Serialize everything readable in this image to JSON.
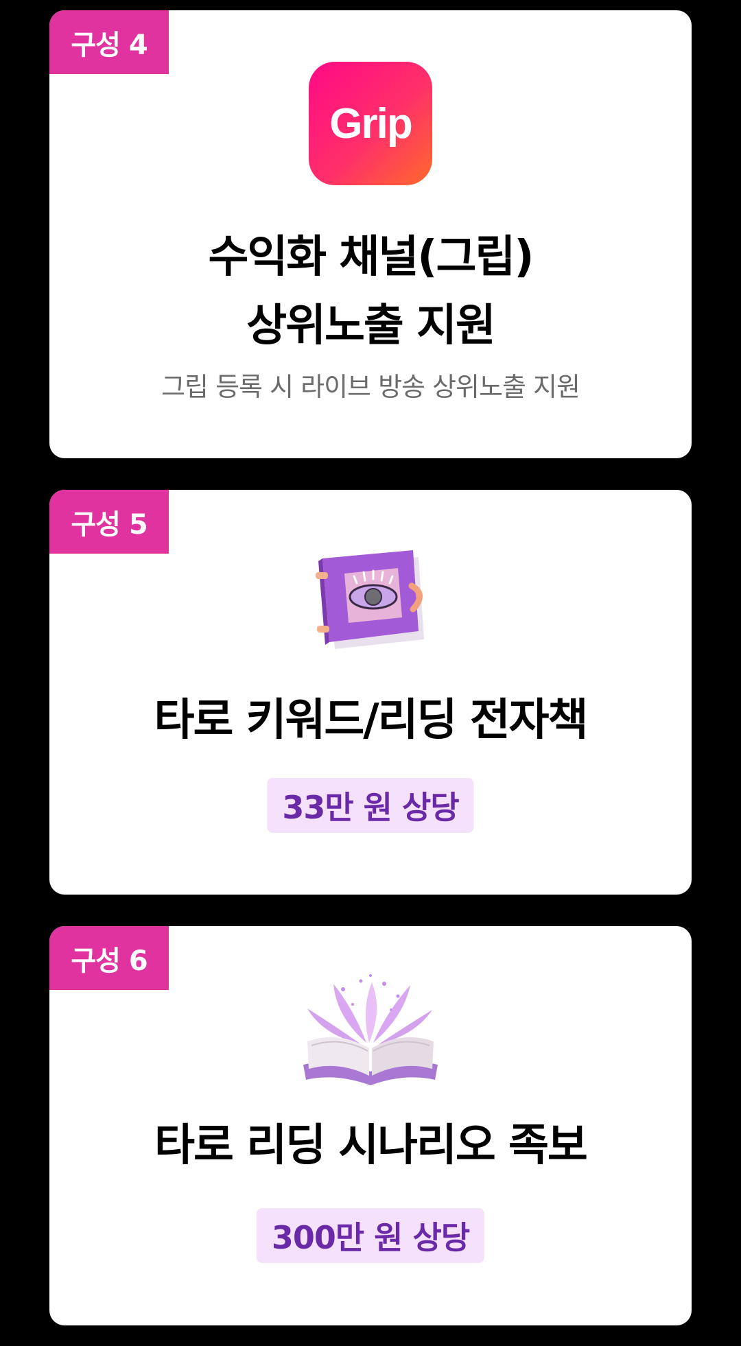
{
  "cards": [
    {
      "tag": "구성 4",
      "logo_text": "Grip",
      "title_line1": "수익화 채널(그립)",
      "title_line2": "상위노출 지원",
      "subtitle": "그립 등록 시 라이브 방송 상위노출 지원",
      "icon": "grip-app-logo"
    },
    {
      "tag": "구성 5",
      "title": "타로 키워드/리딩 전자책",
      "price": "33만 원 상당",
      "icon": "mystic-eye-book-icon"
    },
    {
      "tag": "구성 6",
      "title": "타로 리딩 시나리오 족보",
      "price": "300만 원 상당",
      "icon": "magic-open-book-icon"
    }
  ],
  "colors": {
    "background": "#000000",
    "card": "#ffffff",
    "tag": "#e0339f",
    "price_bg": "#f5e1fb",
    "price_text": "#6a2aa8"
  }
}
